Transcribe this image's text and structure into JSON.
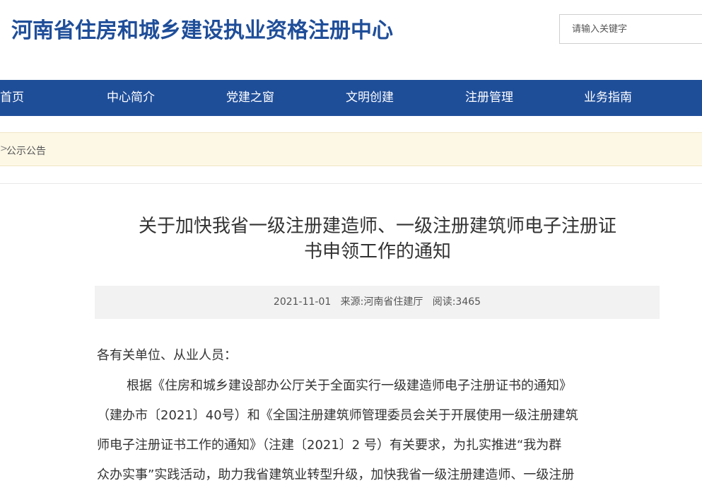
{
  "header": {
    "site_title": "河南省住房和城乡建设执业资格注册中心",
    "search_placeholder": "请输入关键字"
  },
  "nav": {
    "items": [
      {
        "label": "首页"
      },
      {
        "label": "中心简介"
      },
      {
        "label": "党建之窗"
      },
      {
        "label": "文明创建"
      },
      {
        "label": "注册管理"
      },
      {
        "label": "业务指南"
      }
    ]
  },
  "breadcrumb": {
    "separator": ">",
    "current": "公示公告"
  },
  "article": {
    "title_line1": "关于加快我省一级注册建造师、一级注册建筑师电子注册证",
    "title_line2": "书申领工作的通知",
    "date": "2021-11-01",
    "source": "来源:河南省住建厅",
    "reads": "阅读:3465",
    "salutation": "各有关单位、从业人员：",
    "para1_line1": "根据《住房和城乡建设部办公厅关于全面实行一级建造师电子注册证书的通知》",
    "para1_line2": "（建办市〔2021〕40号）和《全国注册建筑师管理委员会关于开展使用一级注册建筑",
    "para1_line3": "师电子注册证书工作的通知》（注建〔2021〕2 号）有关要求，为扎实推进“我为群",
    "para1_line4": "众办实事”实践活动，助力我省建筑业转型升级，加快我省一级注册建造师、一级注册"
  },
  "colors": {
    "brand_blue": "#1f4e99",
    "breadcrumb_bg": "#fdf8e6",
    "meta_bg": "#f2f2f2"
  }
}
